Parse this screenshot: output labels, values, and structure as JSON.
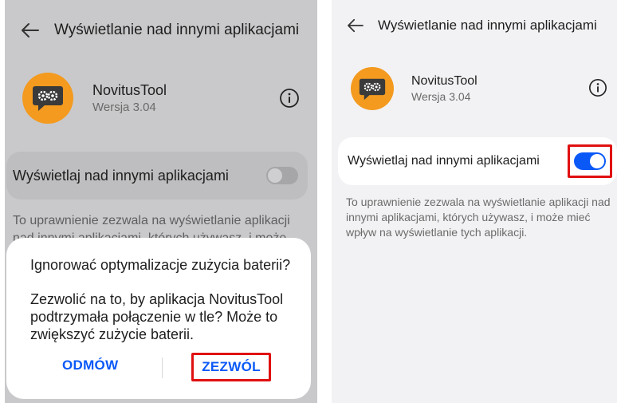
{
  "colors": {
    "accent": "#0a59f7",
    "app_icon": "#f39a1f",
    "highlight": "#e01010"
  },
  "left": {
    "header": {
      "title": "Wyświetlanie nad innymi aplikacjami",
      "back_icon": "back-arrow-icon"
    },
    "app": {
      "name": "NovitusTool",
      "version": "Wersja 3.04",
      "icon": "gears-chat-icon",
      "info_icon": "info-icon"
    },
    "setting": {
      "label": "Wyświetlaj nad innymi aplikacjami",
      "toggle_state": "off"
    },
    "description": "To uprawnienie zezwala na wyświetlanie aplikacji nad innymi aplikacjami, których używasz, i może",
    "dialog": {
      "title": "Ignorować optymalizacje zużycia baterii?",
      "body": "Zezwolić na to, by aplikacja NovitusTool podtrzymała połączenie w tle? Może to zwiększyć zużycie baterii.",
      "deny_label": "ODMÓW",
      "allow_label": "ZEZWÓL"
    }
  },
  "right": {
    "header": {
      "title": "Wyświetlanie nad innymi aplikacjami",
      "back_icon": "back-arrow-icon"
    },
    "app": {
      "name": "NovitusTool",
      "version": "Wersja 3.04",
      "icon": "gears-chat-icon",
      "info_icon": "info-icon"
    },
    "setting": {
      "label": "Wyświetlaj nad innymi aplikacjami",
      "toggle_state": "on"
    },
    "description": "To uprawnienie zezwala na wyświetlanie aplikacji nad innymi aplikacjami, których używasz, i może mieć wpływ na wyświetlanie tych aplikacji."
  }
}
